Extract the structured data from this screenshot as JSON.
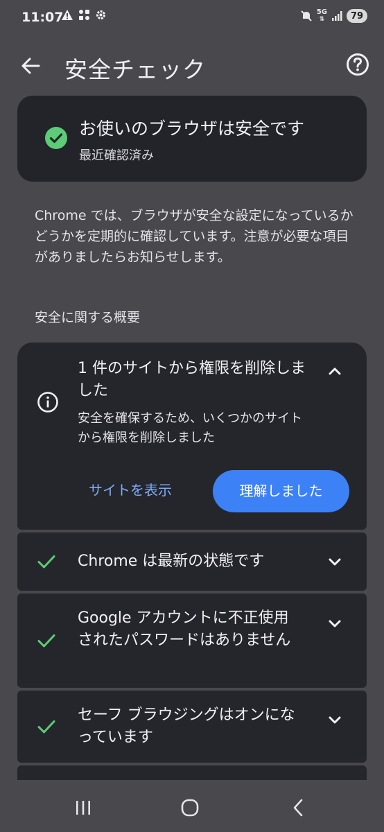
{
  "status_bar": {
    "time": "11:07",
    "network": "5G",
    "battery": "79",
    "icons": [
      "warning-icon",
      "grid-apps-icon",
      "settings-gear-icon",
      "mute-icon",
      "signal-icon"
    ]
  },
  "app_bar": {
    "title": "安全チェック",
    "back_icon": "arrow-back-icon",
    "help_icon": "help-circle-icon"
  },
  "summary": {
    "title": "お使いのブラウザは安全です",
    "subtitle": "最近確認済み",
    "icon": "check-circle-icon",
    "accent": "#5ccc78"
  },
  "description": "Chrome では、ブラウザが安全な設定になっているかどうかを定期的に確認しています。注意が必要な項目がありましたらお知らせします。",
  "section_title": "安全に関する概要",
  "items": [
    {
      "title": "1 件のサイトから権限を削除しました",
      "description": "安全を確保するため、いくつかのサイトから権限を削除しました",
      "icon": "info-icon",
      "expanded": true,
      "secondary_action": "サイトを表示",
      "primary_action": "理解しました"
    },
    {
      "title": "Chrome は最新の状態です",
      "icon": "check-icon",
      "expanded": false
    },
    {
      "title": "Google アカウントに不正使用されたパスワードはありません",
      "icon": "check-icon",
      "expanded": false
    },
    {
      "title": "セーフ ブラウジングはオンになっています",
      "icon": "check-icon",
      "expanded": false
    }
  ],
  "colors": {
    "background": "#49484d",
    "card": "#25262b",
    "primary_button": "#3c82f6",
    "link": "#7eaaf6",
    "check": "#5ccc78"
  },
  "nav_bar": {
    "icons": [
      "recent-apps-icon",
      "home-icon",
      "back-icon"
    ]
  }
}
